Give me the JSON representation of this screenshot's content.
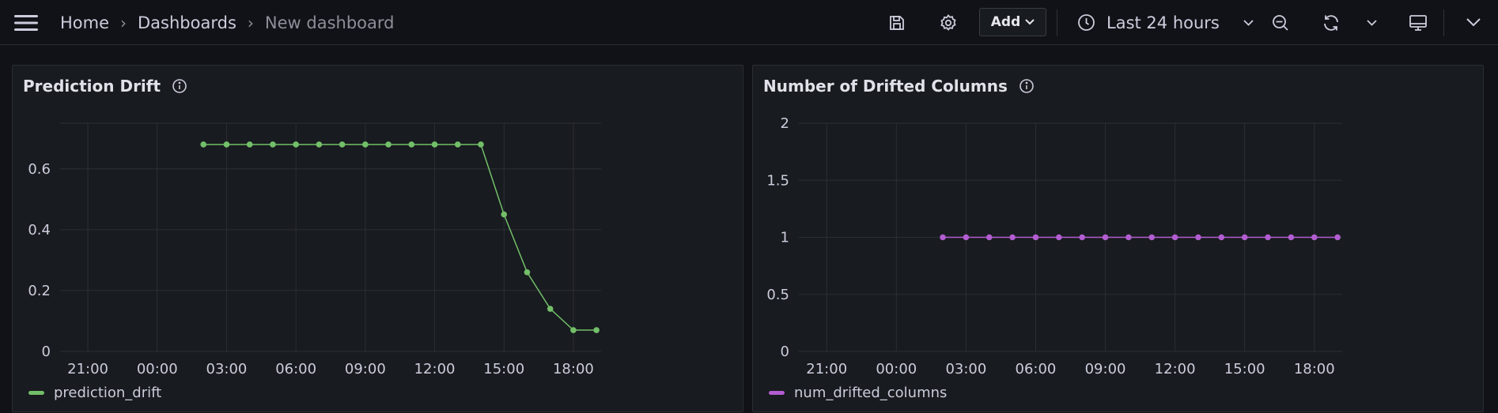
{
  "breadcrumb": {
    "home": "Home",
    "dashboards": "Dashboards",
    "current": "New dashboard",
    "separator": "›"
  },
  "toolbar": {
    "add_label": "Add",
    "time_range": "Last 24 hours"
  },
  "icons": {
    "menu": "hamburger-menu-icon",
    "save": "save-icon",
    "settings": "gear-icon",
    "time": "clock-icon",
    "zoom_out": "zoom-out-icon",
    "refresh": "refresh-icon",
    "tv": "tv-mode-icon",
    "collapse": "chevron-down-icon",
    "info": "info-icon"
  },
  "panels": [
    {
      "title": "Prediction Drift",
      "legend": "prediction_drift",
      "color": "#73bf69"
    },
    {
      "title": "Number of Drifted Columns",
      "legend": "num_drifted_columns",
      "color": "#b25dd1"
    }
  ],
  "chart_data": [
    {
      "type": "line",
      "title": "Prediction Drift",
      "xlabel": "",
      "ylabel": "",
      "x_tick_labels": [
        "21:00",
        "00:00",
        "03:00",
        "06:00",
        "09:00",
        "12:00",
        "15:00",
        "18:00"
      ],
      "y_tick_labels": [
        "0",
        "0.2",
        "0.4",
        "0.6"
      ],
      "ylim": [
        0,
        0.75
      ],
      "grid": true,
      "legend_position": "bottom-left",
      "x_hours": [
        2,
        3,
        4,
        5,
        6,
        7,
        8,
        9,
        10,
        11,
        12,
        13,
        14,
        15,
        16,
        17,
        18,
        19
      ],
      "series": [
        {
          "name": "prediction_drift",
          "color": "#73bf69",
          "values": [
            0.68,
            0.68,
            0.68,
            0.68,
            0.68,
            0.68,
            0.68,
            0.68,
            0.68,
            0.68,
            0.68,
            0.68,
            0.68,
            0.45,
            0.26,
            0.14,
            0.07,
            0.07
          ]
        }
      ]
    },
    {
      "type": "line",
      "title": "Number of Drifted Columns",
      "xlabel": "",
      "ylabel": "",
      "x_tick_labels": [
        "21:00",
        "00:00",
        "03:00",
        "06:00",
        "09:00",
        "12:00",
        "15:00",
        "18:00"
      ],
      "y_tick_labels": [
        "0",
        "0.5",
        "1",
        "1.5",
        "2"
      ],
      "ylim": [
        0,
        2
      ],
      "grid": true,
      "legend_position": "bottom-left",
      "x_hours": [
        2,
        3,
        4,
        5,
        6,
        7,
        8,
        9,
        10,
        11,
        12,
        13,
        14,
        15,
        16,
        17,
        18,
        19
      ],
      "series": [
        {
          "name": "num_drifted_columns",
          "color": "#b25dd1",
          "values": [
            1,
            1,
            1,
            1,
            1,
            1,
            1,
            1,
            1,
            1,
            1,
            1,
            1,
            1,
            1,
            1,
            1,
            1
          ]
        }
      ]
    }
  ]
}
